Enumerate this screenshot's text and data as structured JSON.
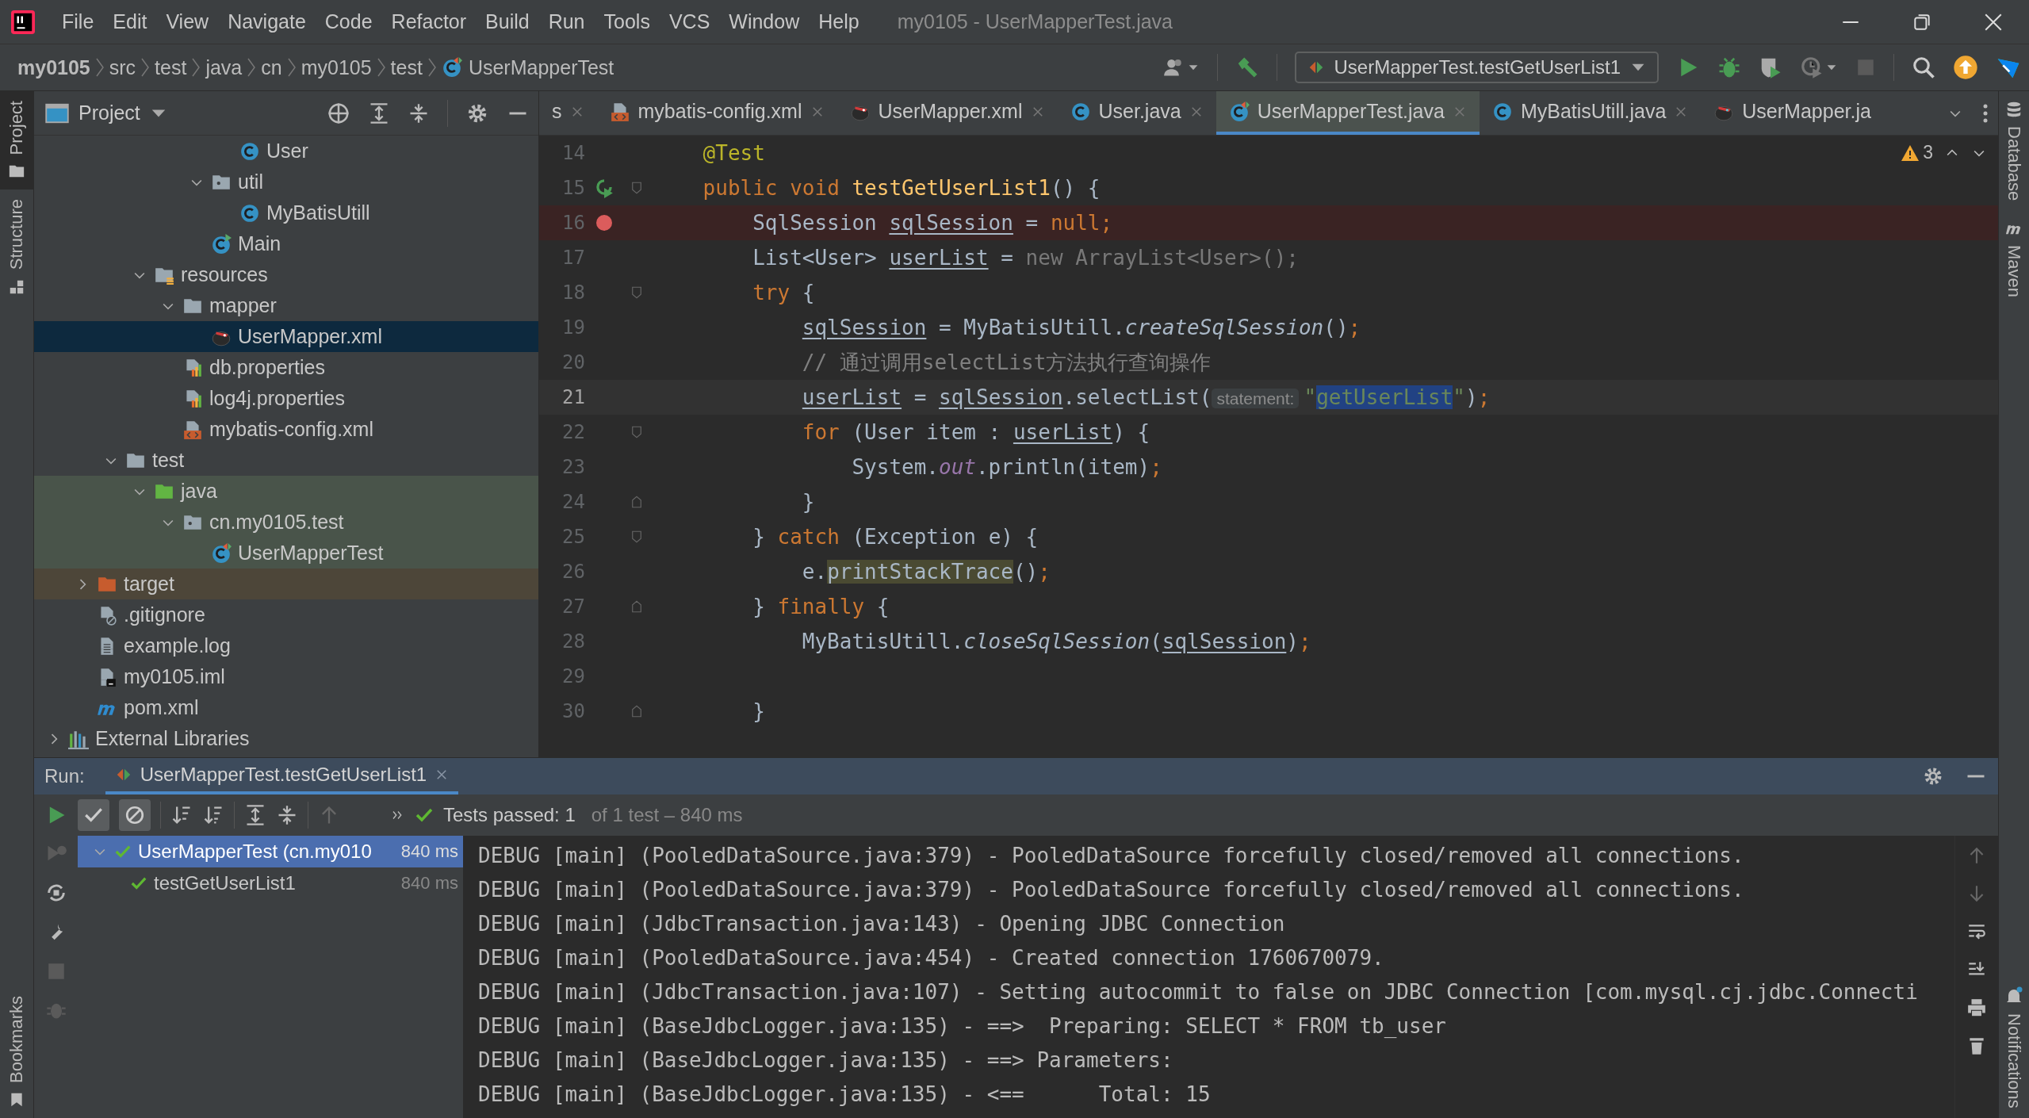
{
  "window": {
    "title": "my0105 - UserMapperTest.java"
  },
  "menu": [
    "File",
    "Edit",
    "View",
    "Navigate",
    "Code",
    "Refactor",
    "Build",
    "Run",
    "Tools",
    "VCS",
    "Window",
    "Help"
  ],
  "breadcrumbs": [
    {
      "label": "my0105",
      "kind": "project"
    },
    {
      "label": "src",
      "kind": "folder"
    },
    {
      "label": "test",
      "kind": "folder"
    },
    {
      "label": "java",
      "kind": "folder"
    },
    {
      "label": "cn",
      "kind": "folder"
    },
    {
      "label": "my0105",
      "kind": "folder"
    },
    {
      "label": "test",
      "kind": "folder"
    },
    {
      "label": "UserMapperTest",
      "kind": "class"
    }
  ],
  "toolbar": {
    "run_config": "UserMapperTest.testGetUserList1"
  },
  "left_stripe": [
    {
      "label": "Project",
      "selected": true
    },
    {
      "label": "Structure",
      "selected": false
    }
  ],
  "bookmarks": "Bookmarks",
  "right_stripe": [
    "Database",
    "Maven"
  ],
  "notifications": "Notifications",
  "project_panel": {
    "title": "Project",
    "tree": [
      {
        "children": [
          {
            "children": [
              {
                "children": [
                  {
                    "children": [
                      {
                        "children": [
                          {
                            "children": [
                              {
                                "label": "User",
                                "kind": "class",
                                "selected": false
                              }
                            ]
                          },
                          {
                            "label": "util",
                            "kind": "package",
                            "expanded": true,
                            "selected": false,
                            "children": [
                              {
                                "label": "MyBatisUtill",
                                "kind": "class",
                                "selected": false
                              }
                            ]
                          },
                          {
                            "label": "Main",
                            "kind": "class-main",
                            "selected": false
                          }
                        ]
                      }
                    ]
                  },
                  {
                    "label": "resources",
                    "kind": "resources-folder",
                    "expanded": true,
                    "selected": false,
                    "children": [
                      {
                        "label": "mapper",
                        "kind": "folder",
                        "expanded": true,
                        "selected": false,
                        "children": [
                          {
                            "label": "UserMapper.xml",
                            "kind": "mybatis-xml",
                            "selected": true
                          }
                        ]
                      },
                      {
                        "label": "db.properties",
                        "kind": "properties",
                        "selected": false
                      },
                      {
                        "label": "log4j.properties",
                        "kind": "properties",
                        "selected": false
                      },
                      {
                        "label": "mybatis-config.xml",
                        "kind": "config-xml",
                        "selected": false
                      }
                    ]
                  }
                ]
              },
              {
                "label": "test",
                "kind": "folder",
                "expanded": true,
                "selected": false,
                "children": [
                  {
                    "label": "java",
                    "kind": "test-folder",
                    "expanded": true,
                    "selected": false,
                    "color": "#49544a",
                    "children": [
                      {
                        "label": "cn.my0105.test",
                        "kind": "package",
                        "expanded": true,
                        "selected": false,
                        "color": "#49544a",
                        "children": [
                          {
                            "label": "UserMapperTest",
                            "kind": "class-test",
                            "selected": false,
                            "color": "#49544a"
                          }
                        ]
                      }
                    ]
                  }
                ]
              }
            ]
          },
          {
            "label": "target",
            "kind": "excluded-folder",
            "expanded": false,
            "selected": false,
            "color": "#4d4639"
          },
          {
            "label": ".gitignore",
            "kind": "gitignore",
            "selected": false
          },
          {
            "label": "example.log",
            "kind": "text-file",
            "selected": false
          },
          {
            "label": "my0105.iml",
            "kind": "iml",
            "selected": false
          },
          {
            "label": "pom.xml",
            "kind": "maven",
            "selected": false
          }
        ]
      },
      {
        "label": "External Libraries",
        "kind": "libraries",
        "expanded": false,
        "selected": false
      }
    ]
  },
  "editor": {
    "tabs": [
      {
        "label": "s",
        "kind": "partial",
        "selected": false,
        "closable": true
      },
      {
        "label": "mybatis-config.xml",
        "kind": "config-xml",
        "selected": false,
        "closable": true
      },
      {
        "label": "UserMapper.xml",
        "kind": "mybatis-xml",
        "selected": false,
        "closable": true
      },
      {
        "label": "User.java",
        "kind": "class",
        "selected": false,
        "closable": true
      },
      {
        "label": "UserMapperTest.java",
        "kind": "class-test",
        "selected": true,
        "closable": true
      },
      {
        "label": "MyBatisUtill.java",
        "kind": "class",
        "selected": false,
        "closable": true
      },
      {
        "label": "UserMapper.ja",
        "kind": "mapper-interface",
        "selected": false,
        "closable": false
      }
    ],
    "warnings": "3",
    "lines": [
      {
        "number": "14",
        "current": false,
        "kind": "member",
        "tokens": [
          {
            "text": "@Test",
            "kind": "annotation"
          }
        ]
      },
      {
        "number": "15",
        "current": false,
        "kind": "member",
        "gutter": {
          "kind": "run"
        },
        "fold": {
          "kind": "start"
        },
        "tokens": [
          {
            "text": "public void ",
            "kind": "keyword"
          },
          {
            "text": "testGetUserList1",
            "kind": "method"
          },
          {
            "text": "() {",
            "kind": "plain"
          }
        ]
      },
      {
        "number": "16",
        "current": false,
        "kind": "body",
        "gutter": {
          "kind": "breakpoint"
        },
        "tokens": [
          {
            "text": "SqlSession ",
            "kind": "plain"
          },
          {
            "text": "sqlSession",
            "kind": "var"
          },
          {
            "text": " = ",
            "kind": "plain"
          },
          {
            "text": "null;",
            "kind": "keyword"
          }
        ]
      },
      {
        "number": "17",
        "current": false,
        "kind": "body",
        "tokens": [
          {
            "text": "List<User> ",
            "kind": "plain"
          },
          {
            "text": "userList",
            "kind": "var"
          },
          {
            "text": " = ",
            "kind": "plain"
          },
          {
            "text": "new ArrayList<User>();",
            "kind": "gray"
          }
        ]
      },
      {
        "number": "18",
        "current": false,
        "kind": "body",
        "fold": {
          "kind": "start"
        },
        "tokens": [
          {
            "text": "try",
            "kind": "keyword"
          },
          {
            "text": " {",
            "kind": "plain"
          }
        ]
      },
      {
        "number": "19",
        "current": false,
        "kind": "block",
        "tokens": [
          {
            "text": "sqlSession",
            "kind": "var"
          },
          {
            "text": " = MyBatisUtill.",
            "kind": "plain"
          },
          {
            "text": "createSqlSession",
            "kind": "italic"
          },
          {
            "text": "()",
            "kind": "plain"
          },
          {
            "text": ";",
            "kind": "keyword"
          }
        ]
      },
      {
        "number": "20",
        "current": false,
        "kind": "block",
        "tokens": [
          {
            "text": "// 通过调用selectList方法执行查询操作",
            "kind": "comment"
          }
        ]
      },
      {
        "number": "21",
        "current": true,
        "kind": "block",
        "tokens": [
          {
            "text": "userList",
            "kind": "var"
          },
          {
            "text": " = ",
            "kind": "plain"
          },
          {
            "text": "sqlSession",
            "kind": "var"
          },
          {
            "text": ".selectList(",
            "kind": "plain"
          },
          {
            "text": "statement:",
            "kind": "hint"
          },
          {
            "text": "\"",
            "kind": "string"
          },
          {
            "text": "getUserList",
            "kind": "selected-string"
          },
          {
            "text": "\"",
            "kind": "string"
          },
          {
            "text": ")",
            "kind": "plain"
          },
          {
            "text": ";",
            "kind": "keyword"
          }
        ]
      },
      {
        "number": "22",
        "current": false,
        "kind": "block",
        "fold": {
          "kind": "start"
        },
        "tokens": [
          {
            "text": "for",
            "kind": "keyword"
          },
          {
            "text": " (User item : ",
            "kind": "plain"
          },
          {
            "text": "userList",
            "kind": "var"
          },
          {
            "text": ") {",
            "kind": "plain"
          }
        ]
      },
      {
        "number": "23",
        "current": false,
        "kind": "nested",
        "tokens": [
          {
            "text": "System.",
            "kind": "plain"
          },
          {
            "text": "out",
            "kind": "static-field"
          },
          {
            "text": ".println(item)",
            "kind": "plain"
          },
          {
            "text": ";",
            "kind": "keyword"
          }
        ]
      },
      {
        "number": "24",
        "current": false,
        "kind": "block",
        "fold": {
          "kind": "end"
        },
        "tokens": [
          {
            "text": "}",
            "kind": "plain"
          }
        ]
      },
      {
        "number": "25",
        "current": false,
        "kind": "body",
        "fold": {
          "kind": "start"
        },
        "tokens": [
          {
            "text": "} ",
            "kind": "plain"
          },
          {
            "text": "catch",
            "kind": "keyword"
          },
          {
            "text": " (Exception e) {",
            "kind": "plain"
          }
        ]
      },
      {
        "number": "26",
        "current": false,
        "kind": "block",
        "tokens": [
          {
            "text": "e.",
            "kind": "plain"
          },
          {
            "text": "printStackTrace",
            "kind": "marked"
          },
          {
            "text": "()",
            "kind": "plain"
          },
          {
            "text": ";",
            "kind": "keyword"
          }
        ]
      },
      {
        "number": "27",
        "current": false,
        "kind": "body",
        "fold": {
          "kind": "end"
        },
        "tokens": [
          {
            "text": "} ",
            "kind": "plain"
          },
          {
            "text": "finally",
            "kind": "keyword"
          },
          {
            "text": " {",
            "kind": "plain"
          }
        ]
      },
      {
        "number": "28",
        "current": false,
        "kind": "block",
        "tokens": [
          {
            "text": "MyBatisUtill.",
            "kind": "plain"
          },
          {
            "text": "closeSqlSession",
            "kind": "italic"
          },
          {
            "text": "(",
            "kind": "plain"
          },
          {
            "text": "sqlSession",
            "kind": "var"
          },
          {
            "text": ")",
            "kind": "plain"
          },
          {
            "text": ";",
            "kind": "keyword"
          }
        ]
      },
      {
        "number": "29",
        "current": false
      },
      {
        "number": "30",
        "current": false,
        "kind": "body",
        "fold": {
          "kind": "end"
        },
        "tokens": [
          {
            "text": "}",
            "kind": "plain"
          }
        ]
      }
    ]
  },
  "run_panel": {
    "label": "Run:",
    "tab": "UserMapperTest.testGetUserList1",
    "status": {
      "passed": "Tests passed: 1",
      "detail": "of 1 test – 840 ms"
    },
    "tests": [
      {
        "label": "UserMapperTest",
        "detail": "(cn.my010",
        "time": "840 ms",
        "selected": true,
        "expanded": true,
        "children": [
          {
            "label": "testGetUserList1",
            "time": "840 ms",
            "selected": false
          }
        ]
      }
    ],
    "console": [
      "DEBUG [main] (PooledDataSource.java:379) - PooledDataSource forcefully closed/removed all connections.",
      "DEBUG [main] (PooledDataSource.java:379) - PooledDataSource forcefully closed/removed all connections.",
      "DEBUG [main] (JdbcTransaction.java:143) - Opening JDBC Connection",
      "DEBUG [main] (PooledDataSource.java:454) - Created connection 1760670079.",
      "DEBUG [main] (JdbcTransaction.java:107) - Setting autocommit to false on JDBC Connection [com.mysql.cj.jdbc.Connecti",
      "DEBUG [main] (BaseJdbcLogger.java:135) - ==>  Preparing: SELECT * FROM tb_user",
      "DEBUG [main] (BaseJdbcLogger.java:135) - ==> Parameters: ",
      "DEBUG [main] (BaseJdbcLogger.java:135) - <==      Total: 15"
    ]
  }
}
